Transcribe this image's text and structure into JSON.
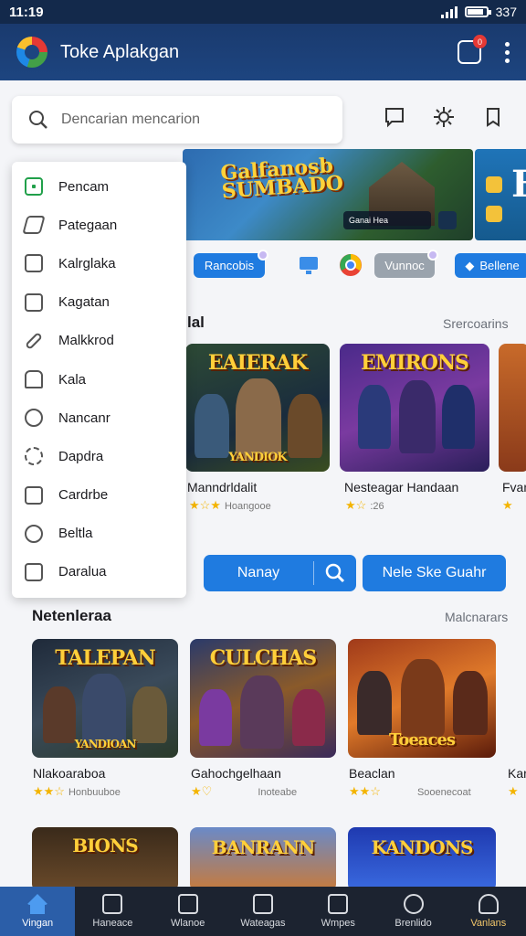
{
  "status_bar": {
    "time": "11:19",
    "battery": "337"
  },
  "app_bar": {
    "title": "Toke Aplakgan",
    "notification_count": "0"
  },
  "search": {
    "placeholder": "Dencarian mencarion"
  },
  "banner": {
    "title_line1": "Galfanosb",
    "title_line2": "SUMBADO",
    "caption": "Ganai Hea",
    "side_letter": "B"
  },
  "chips": [
    {
      "label": "Rancobis"
    },
    {
      "label": "Vunnoc"
    },
    {
      "label": "Bellene"
    }
  ],
  "drawer": {
    "items": [
      {
        "label": "Pencam",
        "icon": "square-icon",
        "active": true
      },
      {
        "label": "Pategaan",
        "icon": "tag-icon"
      },
      {
        "label": "Kalrglaka",
        "icon": "document-icon"
      },
      {
        "label": "Kagatan",
        "icon": "chart-icon"
      },
      {
        "label": "Malkkrod",
        "icon": "pencil-icon"
      },
      {
        "label": "Kala",
        "icon": "puzzle-icon"
      },
      {
        "label": "Nancanr",
        "icon": "chat-icon"
      },
      {
        "label": "Dapdra",
        "icon": "badge-icon"
      },
      {
        "label": "Cardrbe",
        "icon": "mail-icon"
      },
      {
        "label": "Beltla",
        "icon": "compass-icon"
      },
      {
        "label": "Daralua",
        "icon": "calendar-icon"
      }
    ]
  },
  "section1": {
    "title": "lal",
    "link": "Srercoarins",
    "cards": [
      {
        "title_art": "EAIERAK",
        "subtitle_art": "YANDIOK",
        "name": "Manndrldalit",
        "rating": "★☆★",
        "meta": "Hoangooe"
      },
      {
        "title_art": "EMIRONS",
        "subtitle_art": "",
        "name": "Nesteagar Handaan",
        "rating": "★☆",
        "meta": ":26"
      },
      {
        "title_art": "",
        "subtitle_art": "",
        "name": "Fvan",
        "rating": "★",
        "meta": ""
      }
    ]
  },
  "actions": {
    "btn1": "Nanay",
    "btn2": "Nele Ske Guahr"
  },
  "section2": {
    "title": "Netenleraa",
    "link": "Malcnarars",
    "cards": [
      {
        "title_art": "TALEPAN",
        "subtitle_art": "YANDIOAN",
        "name": "Nlakoaraboa",
        "rating": "★★☆",
        "meta": "Honbuuboe"
      },
      {
        "title_art": "CULCHAS",
        "subtitle_art": "",
        "name": "Gahochgelhaan",
        "rating": "★♡",
        "meta": "Inoteabe"
      },
      {
        "title_art": "",
        "subtitle_art": "Toeaces",
        "name": "Beaclan",
        "rating": "★★☆",
        "meta": "Sooenecoat"
      },
      {
        "title_art": "",
        "subtitle_art": "",
        "name": "Kar",
        "rating": "★",
        "meta": ""
      }
    ]
  },
  "section3": {
    "cards": [
      {
        "title_art": "BIONS"
      },
      {
        "title_art": "BANRANN"
      },
      {
        "title_art": "KANDONS"
      }
    ]
  },
  "bottom_nav": [
    {
      "label": "Vingan",
      "icon": "home-icon",
      "active": true
    },
    {
      "label": "Haneace",
      "icon": "house-icon"
    },
    {
      "label": "Wlanoe",
      "icon": "list-icon"
    },
    {
      "label": "Wateagas",
      "icon": "store-icon"
    },
    {
      "label": "Wmpes",
      "icon": "puzzle-icon"
    },
    {
      "label": "Brenlido",
      "icon": "search-icon"
    },
    {
      "label": "Vanlans",
      "icon": "person-icon"
    }
  ],
  "colors": {
    "app_bar": "#1d4580",
    "accent": "#1f7be0",
    "nav_bg": "#1c2330",
    "active_green": "#21a04a"
  }
}
